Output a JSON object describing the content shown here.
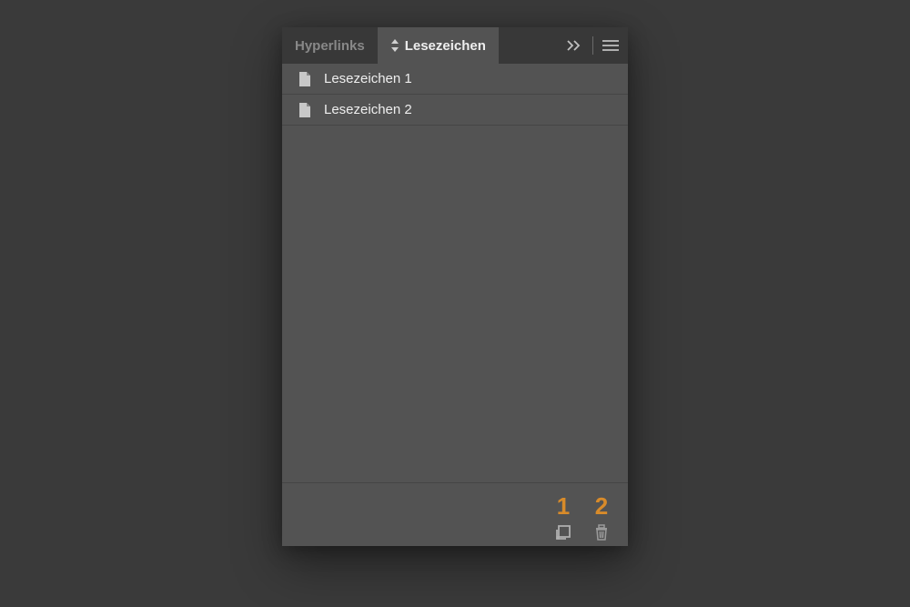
{
  "tabs": {
    "hyperlinks": "Hyperlinks",
    "bookmarks": "Lesezeichen"
  },
  "bookmarks": {
    "items": [
      {
        "label": "Lesezeichen 1"
      },
      {
        "label": "Lesezeichen 2"
      }
    ]
  },
  "footer": {
    "annotation_new": "1",
    "annotation_delete": "2"
  }
}
